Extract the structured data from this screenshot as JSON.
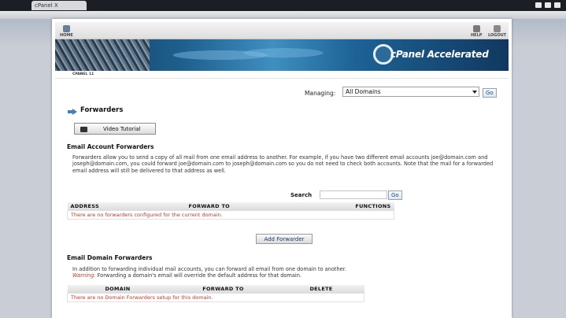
{
  "browser": {
    "tab_title": "cPanel X"
  },
  "topnav": {
    "home_label": "HOME",
    "help_label": "HELP",
    "logout_label": "LOGOUT"
  },
  "banner": {
    "brand": "cPanel Accelerated"
  },
  "subnav": {
    "version": "CPANEL 11"
  },
  "managing": {
    "label": "Managing:",
    "selected": "All Domains",
    "go_label": "Go"
  },
  "page": {
    "title": "Forwarders",
    "video_button": "Video Tutorial"
  },
  "email_account_forwarders": {
    "heading": "Email Account Forwarders",
    "description": "Forwarders allow you to send a copy of all mail from one email address to another. For example, if you have two different email accounts joe@domain.com and joseph@domain.com, you could forward joe@domain.com to joseph@domain.com so you do not need to check both accounts. Note that the mail for a forwarded email address will still be delivered to that address as well.",
    "search_label": "Search",
    "search_go": "Go",
    "columns": [
      "Address",
      "Forward To",
      "Functions"
    ],
    "empty_message": "There are no forwarders configured for the current domain.",
    "add_button": "Add Forwarder"
  },
  "email_domain_forwarders": {
    "heading": "Email Domain Forwarders",
    "description": "In addition to forwarding individual mail accounts, you can forward all email from one domain to another.",
    "warning_label": "Warning:",
    "warning_text": "Forwarding a domain's email will override the default address for that domain.",
    "columns": [
      "Domain",
      "Forward To",
      "Delete"
    ],
    "empty_message": "There are no Domain Forwarders setup for this domain."
  },
  "colors": {
    "banner_dark": "#173a60",
    "banner_light": "#3f8fc0",
    "warning_red": "#c0392b"
  }
}
